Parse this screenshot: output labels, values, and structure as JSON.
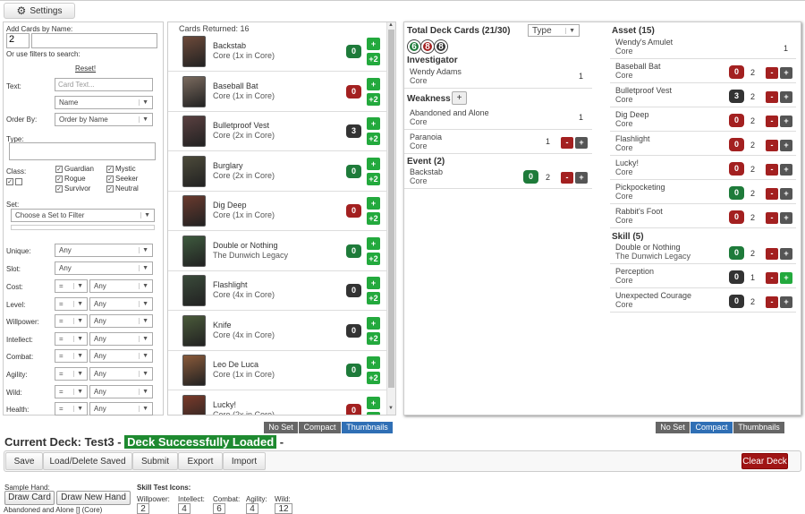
{
  "settings": {
    "label": "Settings",
    "icon": "gear-icon"
  },
  "filters": {
    "add_cards_label": "Add Cards by Name:",
    "qty_value": "2",
    "or_filters": "Or use filters to search:",
    "reset": "Reset!",
    "text_label": "Text:",
    "text_placeholder": "Card Text...",
    "text_field": "Name",
    "order_label": "Order By:",
    "order_value": "Order by Name",
    "type_label": "Type:",
    "class_label": "Class:",
    "classes": [
      "Guardian",
      "Mystic",
      "Rogue",
      "Seeker",
      "Survivor",
      "Neutral"
    ],
    "set_label": "Set:",
    "set_value": "Choose a Set to Filter",
    "unique_label": "Unique:",
    "unique_value": "Any",
    "slot_label": "Slot:",
    "slot_value": "Any",
    "stats": [
      {
        "label": "Cost:",
        "op": "=",
        "val": "Any"
      },
      {
        "label": "Level:",
        "op": "=",
        "val": "Any"
      },
      {
        "label": "Willpower:",
        "op": "=",
        "val": "Any"
      },
      {
        "label": "Intellect:",
        "op": "=",
        "val": "Any"
      },
      {
        "label": "Combat:",
        "op": "=",
        "val": "Any"
      },
      {
        "label": "Agility:",
        "op": "=",
        "val": "Any"
      },
      {
        "label": "Wild:",
        "op": "=",
        "val": "Any"
      },
      {
        "label": "Health:",
        "op": "=",
        "val": "Any"
      }
    ]
  },
  "results": {
    "header": "Cards Returned: 16",
    "cards": [
      {
        "name": "Backstab",
        "set": "Core (1x in Core)",
        "qty": "0",
        "qcolor": "green",
        "art": "#6d4a3a"
      },
      {
        "name": "Baseball Bat",
        "set": "Core (1x in Core)",
        "qty": "0",
        "qcolor": "red",
        "art": "#7a6a5e"
      },
      {
        "name": "Bulletproof Vest",
        "set": "Core (2x in Core)",
        "qty": "3",
        "qcolor": "dark",
        "art": "#5a4040"
      },
      {
        "name": "Burglary",
        "set": "Core (2x in Core)",
        "qty": "0",
        "qcolor": "green",
        "art": "#4c4a3a"
      },
      {
        "name": "Dig Deep",
        "set": "Core (1x in Core)",
        "qty": "0",
        "qcolor": "red",
        "art": "#6a3a2e"
      },
      {
        "name": "Double or Nothing",
        "set": "The Dunwich Legacy",
        "qty": "0",
        "qcolor": "green",
        "art": "#3e5a3e"
      },
      {
        "name": "Flashlight",
        "set": "Core (4x in Core)",
        "qty": "0",
        "qcolor": "dark",
        "art": "#3a4a3a"
      },
      {
        "name": "Knife",
        "set": "Core (4x in Core)",
        "qty": "0",
        "qcolor": "dark",
        "art": "#4a5a3a"
      },
      {
        "name": "Leo De Luca",
        "set": "Core (1x in Core)",
        "qty": "0",
        "qcolor": "green",
        "art": "#8a5a3a"
      },
      {
        "name": "Lucky!",
        "set": "Core (2x in Core)",
        "qty": "0",
        "qcolor": "red",
        "art": "#7a3a2a"
      }
    ],
    "plus1": "+",
    "plus2": "+2"
  },
  "deck": {
    "total": "Total Deck Cards (21/30)",
    "sort": "Type",
    "counts": [
      "6",
      "8",
      "8"
    ],
    "count_colors": [
      "#1e7b3a",
      "#a32020",
      "#333333"
    ],
    "investigator_h": "Investigator",
    "investigator": {
      "name": "Wendy Adams",
      "set": "Core",
      "n": "1"
    },
    "weakness_h": "Weakness",
    "weaknesses": [
      {
        "name": "Abandoned and Alone",
        "set": "Core",
        "n": "1"
      },
      {
        "name": "Paranoia",
        "set": "Core",
        "n": "1"
      }
    ],
    "event_h": "Event (2)",
    "events": [
      {
        "name": "Backstab",
        "set": "Core",
        "q": "0",
        "n": "2"
      }
    ],
    "asset_h": "Asset (15)",
    "assets": [
      {
        "name": "Wendy's Amulet",
        "set": "Core",
        "q": "",
        "n": "1",
        "qc": ""
      },
      {
        "name": "Baseball Bat",
        "set": "Core",
        "q": "0",
        "n": "2",
        "qc": "red"
      },
      {
        "name": "Bulletproof Vest",
        "set": "Core",
        "q": "3",
        "n": "2",
        "qc": "dark"
      },
      {
        "name": "Dig Deep",
        "set": "Core",
        "q": "0",
        "n": "2",
        "qc": "red"
      },
      {
        "name": "Flashlight",
        "set": "Core",
        "q": "0",
        "n": "2",
        "qc": "red"
      },
      {
        "name": "Lucky!",
        "set": "Core",
        "q": "0",
        "n": "2",
        "qc": "red"
      },
      {
        "name": "Pickpocketing",
        "set": "Core",
        "q": "0",
        "n": "2",
        "qc": "green"
      },
      {
        "name": "Rabbit's Foot",
        "set": "Core",
        "q": "0",
        "n": "2",
        "qc": "red"
      }
    ],
    "skill_h": "Skill (5)",
    "skills": [
      {
        "name": "Double or Nothing",
        "set": "The Dunwich Legacy",
        "q": "0",
        "n": "2",
        "qc": "green"
      },
      {
        "name": "Perception",
        "set": "Core",
        "q": "0",
        "n": "1",
        "qc": "dark"
      },
      {
        "name": "Unexpected Courage",
        "set": "Core",
        "q": "0",
        "n": "2",
        "qc": "dark"
      }
    ]
  },
  "view_toggles_mid": [
    "No Set",
    "Compact",
    "Thumbnails"
  ],
  "view_toggles_right": [
    "No Set",
    "Compact",
    "Thumbnails"
  ],
  "current_deck": {
    "label": "Current Deck: Test3",
    "sep": " - ",
    "status": "Deck Successfully Loaded",
    "dash": "-"
  },
  "toolbar": {
    "save": "Save",
    "load": "Load/Delete Saved",
    "submit": "Submit",
    "export": "Export",
    "import": "Import",
    "clear": "Clear Deck"
  },
  "hand": {
    "label": "Sample Hand:",
    "draw": "Draw Card",
    "new": "Draw New Hand",
    "first": "Abandoned and Alone [] (Core)"
  },
  "skill_test": {
    "label": "Skill Test Icons:",
    "stats": [
      {
        "name": "Willpower:",
        "val": "2"
      },
      {
        "name": "Intellect:",
        "val": "4"
      },
      {
        "name": "Combat:",
        "val": "6"
      },
      {
        "name": "Agility:",
        "val": "4"
      },
      {
        "name": "Wild:",
        "val": "12"
      }
    ]
  }
}
